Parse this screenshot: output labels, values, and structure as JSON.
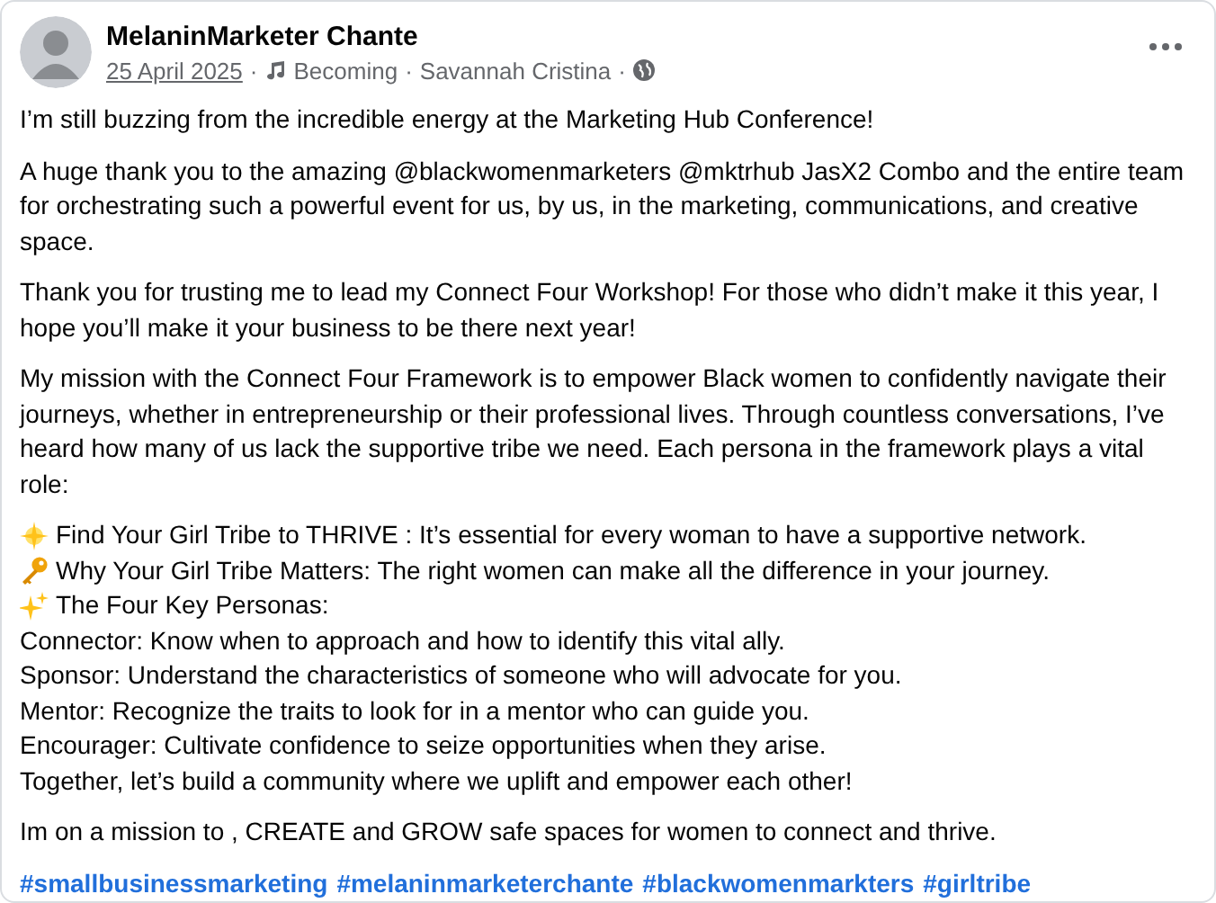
{
  "post": {
    "author": "MelaninMarketer Chante",
    "date": "25 April 2025",
    "song": "Becoming",
    "artist": "Savannah Cristina",
    "separators": [
      "·",
      "·",
      "·"
    ]
  },
  "paragraphs": [
    "I’m still buzzing from the incredible energy at the Marketing Hub Conference!",
    "A huge thank you to the amazing @blackwomenmarketers @mktrhub  JasX2 Combo and the entire team for orchestrating such a powerful event for us, by us, in the marketing, communications, and creative space.",
    "Thank you for trusting me to lead my Connect Four Workshop! For those who didn’t make it this year, I hope you’ll make it your business to be there next year!",
    "My mission with the Connect Four Framework is to empower Black women to confidently navigate their journeys, whether in entrepreneurship or their professional lives. Through countless conversations, I’ve heard how many of us lack the supportive tribe we need. Each persona in the framework plays a vital role:"
  ],
  "lines": [
    {
      "kind": "star",
      "text": "Find Your Girl Tribe to THRIVE : It’s essential for every woman to have a supportive network."
    },
    {
      "kind": "key",
      "text": "Why Your Girl Tribe Matters: The right women can make all the difference in your journey."
    },
    {
      "kind": "sparkles",
      "text": "The Four Key Personas:"
    },
    {
      "kind": "plain",
      "text": "Connector: Know when to approach and how to identify this vital ally."
    },
    {
      "kind": "plain",
      "text": "Sponsor: Understand the characteristics of someone who will advocate for you."
    },
    {
      "kind": "plain",
      "text": "Mentor: Recognize the traits to look for in a mentor who can guide you."
    },
    {
      "kind": "plain",
      "text": "Encourager: Cultivate confidence to seize opportunities when they arise."
    },
    {
      "kind": "plain",
      "text": "Together, let’s build a community where we uplift and empower each other!"
    }
  ],
  "closing": "Im on a mission to , CREATE  and GROW safe spaces for women to connect and thrive.",
  "hashtags": [
    "#smallbusinessmarketing",
    "#melaninmarketerchante",
    "#blackwomenmarkters",
    "#girltribe"
  ]
}
